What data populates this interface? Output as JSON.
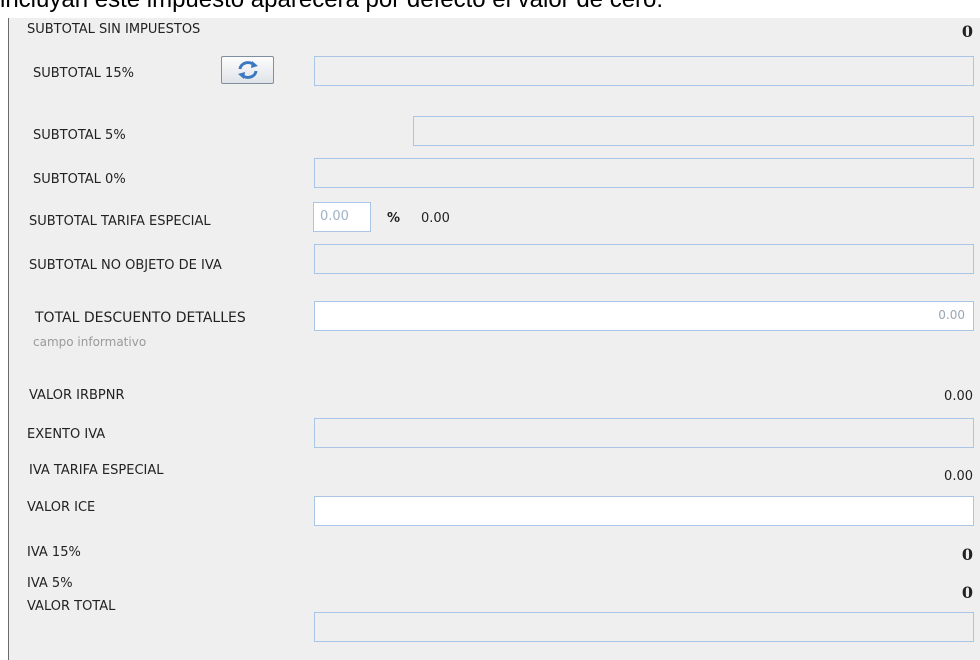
{
  "top_text": "incluyan este impuesto aparecerá por defecto el valor de cero.",
  "labels": {
    "subtotal_sin_impuestos": "SUBTOTAL SIN IMPUESTOS",
    "subtotal_15": "SUBTOTAL 15%",
    "subtotal_5": "SUBTOTAL 5%",
    "subtotal_0": "SUBTOTAL 0%",
    "subtotal_tarifa_especial": "SUBTOTAL TARIFA ESPECIAL",
    "subtotal_no_objeto_iva": "SUBTOTAL NO OBJETO DE IVA",
    "total_descuento_detalles": "TOTAL DESCUENTO DETALLES",
    "campo_informativo": "campo informativo",
    "valor_irbpnr": "VALOR IRBPNR",
    "exento_iva": "EXENTO IVA",
    "iva_tarifa_especial": "IVA TARIFA ESPECIAL",
    "valor_ice": "VALOR ICE",
    "iva_15": "IVA  15%",
    "iva_5": "IVA 5%",
    "valor_total": "VALOR TOTAL"
  },
  "values": {
    "subtotal_sin_impuestos": "0",
    "tarifa_especial_input": "0.00",
    "percent_sign": "%",
    "tarifa_especial_value": "0.00",
    "total_descuento_detalles": "0.00",
    "valor_irbpnr": "0.00",
    "iva_tarifa_especial": "0.00",
    "iva_15": "0",
    "iva_5": "0"
  },
  "icons": {
    "refresh": "refresh-icon"
  }
}
